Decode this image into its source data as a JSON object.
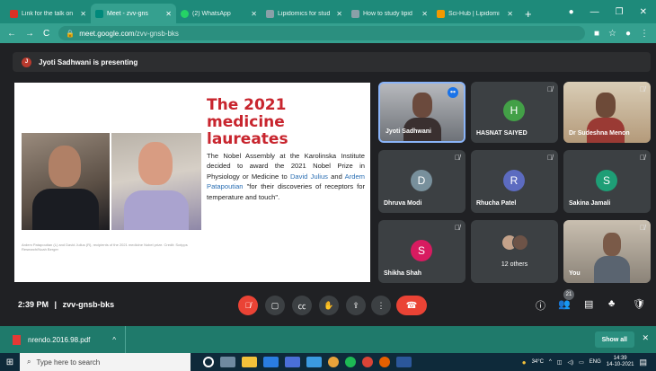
{
  "browser": {
    "tabs": [
      {
        "title": "Link for the talk on",
        "color": "#d93025",
        "active": false
      },
      {
        "title": "Meet - zvv-gns",
        "color": "#00897b",
        "active": true
      },
      {
        "title": "(2) WhatsApp",
        "color": "#25d366",
        "active": false
      },
      {
        "title": "Lipidomics for stud",
        "color": "#8aa0a8",
        "active": false
      },
      {
        "title": "How to study lipid",
        "color": "#8aa0a8",
        "active": false
      },
      {
        "title": "Sci-Hub | Lipidomi",
        "color": "#f29900",
        "active": false
      }
    ],
    "new_tab": "+",
    "url_host": "meet.google.com",
    "url_path": "/zvv-gnsb-bks"
  },
  "presenting": {
    "initial": "J",
    "text": "Jyoti Sadhwani is presenting"
  },
  "slide": {
    "title": "The 2021 medicine laureates",
    "body_pre": "The Nobel Assembly at the Karolinska Institute decided to award the 2021 Nobel Prize in Physiology or Medicine to ",
    "link1": "David Julius",
    "body_mid": " and ",
    "link2": "Ardem Patapoutian",
    "body_post": " \"for their discoveries of receptors for temperature and touch\".",
    "caption": "Ardem Patapoutian (L) and David Julius (R), recipients of the 2021 medicine Nobel prize. Credit: Scripps Research/Noah Berger"
  },
  "participants": [
    {
      "name": "Jyoti Sadhwani",
      "type": "video"
    },
    {
      "name": "HASNAT SAIYED",
      "initial": "H",
      "color": "#43a047"
    },
    {
      "name": "Dr Sudeshna Menon",
      "type": "video"
    },
    {
      "name": "Dhruva Modi",
      "initial": "D",
      "color": "#78909c"
    },
    {
      "name": "Rhucha Patel",
      "initial": "R",
      "color": "#5c6bc0"
    },
    {
      "name": "Sakina Jamali",
      "initial": "S",
      "color": "#1e9e76"
    },
    {
      "name": "Shikha Shah",
      "initial": "S",
      "color": "#d81b60"
    },
    {
      "name": "12 others",
      "type": "others"
    },
    {
      "name": "You",
      "type": "video"
    }
  ],
  "meeting": {
    "time": "2:39 PM",
    "separator": "|",
    "code": "zvv-gnsb-bks",
    "participant_count": "21"
  },
  "download": {
    "filename": "nrendo.2016.98.pdf",
    "show_all": "Show all"
  },
  "taskbar": {
    "search_placeholder": "Type here to search",
    "temperature": "34°C",
    "lang": "ENG",
    "time": "14:39",
    "date": "14-10-2021"
  }
}
